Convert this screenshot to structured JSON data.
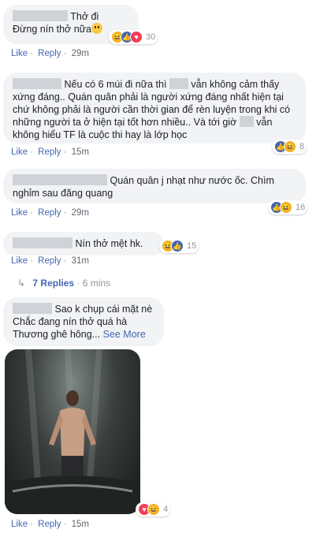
{
  "actions": {
    "like": "Like",
    "reply": "Reply",
    "see_more": "See More"
  },
  "comments": [
    {
      "lines": [
        "Thở đi",
        "Đừng nín thở nữa"
      ],
      "reaction_count": "30",
      "reactions": [
        "haha",
        "like",
        "love"
      ],
      "time": "29m"
    },
    {
      "lines": [
        "Nếu có 6 múi đi nữa thì",
        "vẫn không cảm thấy",
        "xứng đáng.. Quán quân phải là người xứng đáng nhất hiện tại",
        "chứ không phải là người cần thời gian để rèn luyện trong khi có",
        "những người ta ở hiện tại tốt hơn nhiều.. Và tới giờ",
        "vẫn",
        "không hiểu TF là cuộc thi hay là lớp học"
      ],
      "reaction_count": "8",
      "reactions": [
        "like",
        "haha"
      ],
      "time": "15m"
    },
    {
      "lines": [
        "Quán quân j nhạt như nước ốc. Chìm",
        "nghỉm sau đăng quang"
      ],
      "reaction_count": "16",
      "reactions": [
        "like",
        "haha"
      ],
      "time": "29m"
    },
    {
      "lines": [
        "Nín thở mệt hk."
      ],
      "reaction_count": "15",
      "reactions": [
        "haha",
        "like"
      ],
      "time": "31m"
    },
    {
      "lines": [
        "Sao k chụp cái mặt nè",
        "Chắc đang nín thở quá hà",
        "Thương ghê hông..."
      ],
      "reaction_count": "4",
      "reactions": [
        "love",
        "haha"
      ],
      "time": "15m"
    }
  ],
  "replies_link": {
    "label": "7 Replies",
    "time": "6 mins"
  },
  "icons": {
    "reply_arrow": "reply-arrow-icon",
    "emoji": "smiling-face-icon",
    "photo": "photo-shirtless-man-waterfall"
  },
  "colors": {
    "link": "#4267b2",
    "bubble": "#f2f3f5",
    "meta": "#90949c"
  }
}
